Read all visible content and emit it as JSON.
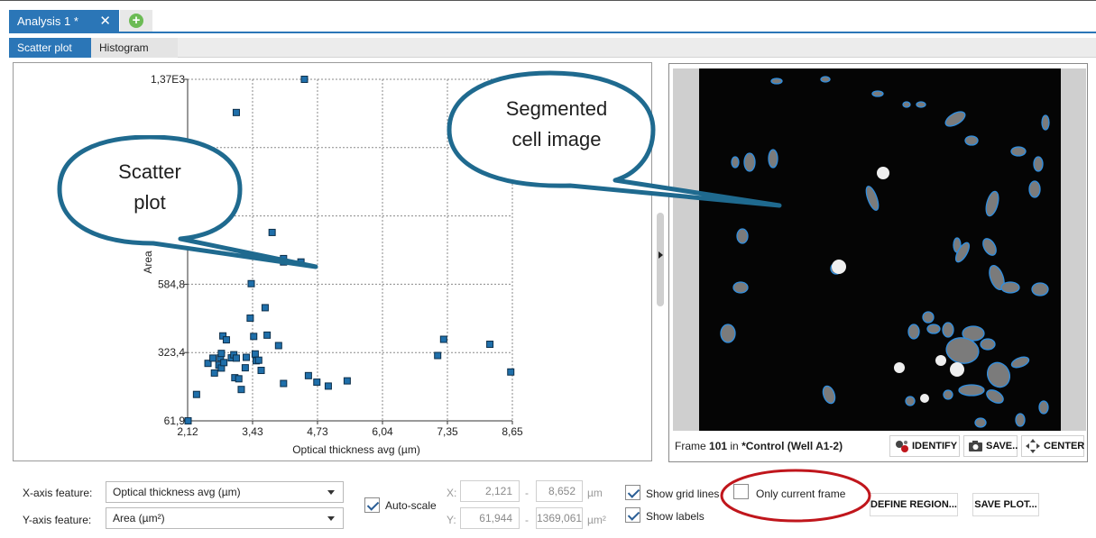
{
  "tabs": {
    "doc_tab_label": "Analysis 1 *",
    "close_glyph": "✕",
    "add_glyph": "+"
  },
  "subtabs": [
    {
      "label": "Scatter plot",
      "active": true
    },
    {
      "label": "Histogram",
      "active": false
    }
  ],
  "callouts": {
    "scatter": [
      "Scatter",
      "plot"
    ],
    "segmented": [
      "Segmented",
      "cell image"
    ]
  },
  "chart_data": {
    "type": "scatter",
    "xlabel": "Optical thickness avg (µm)",
    "ylabel": "Area",
    "x_ticks": [
      "2,12",
      "3,43",
      "4,73",
      "6,04",
      "7,35",
      "8,65"
    ],
    "x_tick_values": [
      2.121,
      3.427,
      4.733,
      6.04,
      7.346,
      8.652
    ],
    "y_ticks": [
      "61,9",
      "323,4",
      "584,8",
      "",
      "",
      "1,37E3"
    ],
    "y_tick_values": [
      61.944,
      323.368,
      584.79,
      846.216,
      1107.638,
      1369.061
    ],
    "xlim": [
      2.121,
      8.652
    ],
    "ylim": [
      61.944,
      1369.061
    ],
    "grid": true,
    "marker_color": "#1f6faa",
    "points": [
      [
        2.13,
        62
      ],
      [
        2.3,
        163
      ],
      [
        2.53,
        282
      ],
      [
        2.63,
        302
      ],
      [
        2.66,
        245
      ],
      [
        2.78,
        303
      ],
      [
        2.8,
        320
      ],
      [
        2.75,
        275
      ],
      [
        2.8,
        264
      ],
      [
        2.85,
        285
      ],
      [
        2.83,
        387
      ],
      [
        2.9,
        372
      ],
      [
        3.0,
        303
      ],
      [
        3.05,
        315
      ],
      [
        3.07,
        227
      ],
      [
        3.1,
        302
      ],
      [
        3.15,
        223
      ],
      [
        3.2,
        182
      ],
      [
        3.28,
        265
      ],
      [
        3.3,
        305
      ],
      [
        3.38,
        455
      ],
      [
        3.4,
        587
      ],
      [
        3.45,
        385
      ],
      [
        3.48,
        318
      ],
      [
        3.5,
        292
      ],
      [
        3.55,
        294
      ],
      [
        3.6,
        255
      ],
      [
        3.68,
        495
      ],
      [
        3.72,
        390
      ],
      [
        3.82,
        783
      ],
      [
        3.95,
        350
      ],
      [
        4.05,
        670
      ],
      [
        4.05,
        683
      ],
      [
        4.05,
        205
      ],
      [
        4.4,
        670
      ],
      [
        4.55,
        235
      ],
      [
        4.72,
        210
      ],
      [
        4.95,
        195
      ],
      [
        5.33,
        215
      ],
      [
        4.47,
        1369
      ],
      [
        3.1,
        1242
      ],
      [
        7.15,
        312
      ],
      [
        7.27,
        374
      ],
      [
        8.2,
        355
      ],
      [
        8.62,
        249
      ]
    ]
  },
  "image_panel": {
    "frame_label": "Frame",
    "frame_number": "101",
    "frame_in": "in",
    "frame_source": "*Control (Well A1-2)",
    "buttons": {
      "identify": "IDENTIFY",
      "save": "SAVE..",
      "center": "CENTER"
    }
  },
  "controls": {
    "x_axis_label": "X-axis feature:",
    "x_axis_value": "Optical thickness avg (µm)",
    "y_axis_label": "Y-axis feature:",
    "y_axis_value": "Area (µm²)",
    "autoscale_label": "Auto-scale",
    "autoscale_checked": true,
    "x_prefix": "X:",
    "y_prefix": "Y:",
    "x_min": "2,121",
    "x_max": "8,652",
    "x_unit": "µm",
    "y_min": "61,944",
    "y_max": "1369,061",
    "y_unit": "µm²",
    "range_sep": "-",
    "show_grid_label": "Show grid lines",
    "show_grid_checked": true,
    "show_labels_label": "Show labels",
    "show_labels_checked": true,
    "only_current_label": "Only current frame",
    "only_current_checked": false,
    "define_region_label": "DEFINE REGION...",
    "save_plot_label": "SAVE PLOT..."
  },
  "colors": {
    "accent": "#2b76b7",
    "annotation_ellipse": "#c0161c",
    "callout_stroke": "#1f6a8f"
  }
}
